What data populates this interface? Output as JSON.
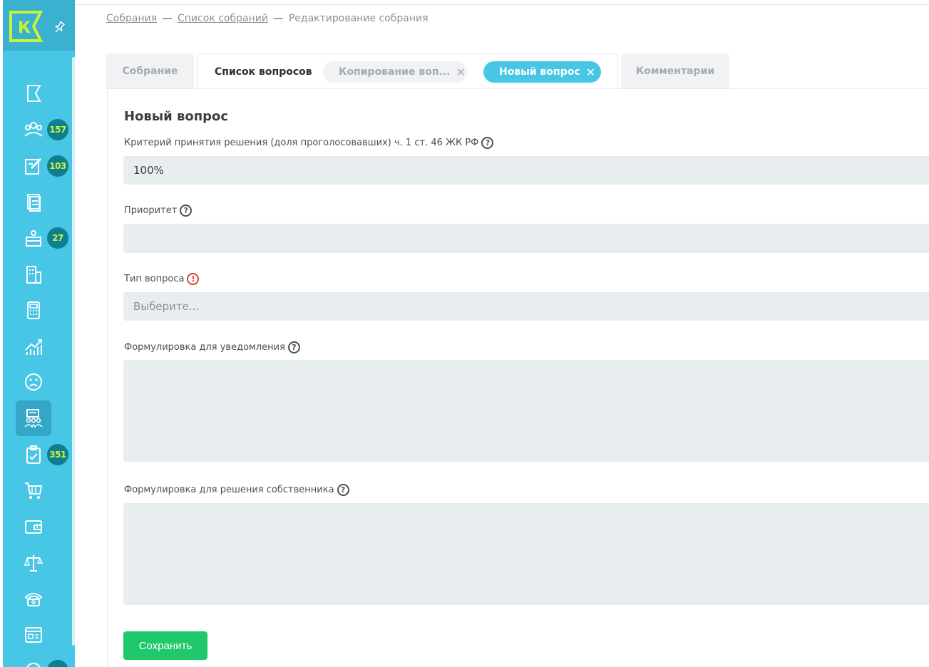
{
  "breadcrumb": {
    "item1": "Собрания",
    "sep": "—",
    "item2": "Список собраний",
    "current": "Редактирование собрания"
  },
  "tabs": {
    "meeting": "Собрание",
    "questions": "Список вопросов",
    "copy": "Копирование воп...",
    "new_question": "Новый вопрос",
    "comments": "Комментарии",
    "close_glyph": "✕"
  },
  "form": {
    "title": "Новый вопрос",
    "criterion_label": "Критерий принятия решения (доля проголосовавших) ч. 1 ст. 46 ЖК РФ",
    "criterion_value": "100%",
    "priority_label": "Приоритет",
    "priority_value": "",
    "type_label": "Тип вопроса",
    "type_placeholder": "Выберите...",
    "notice_label": "Формулировка для уведомления",
    "decision_label": "Формулировка для решения собственника",
    "help_glyph": "?",
    "warn_glyph": "!",
    "save_label": "Сохранить"
  },
  "sidebar": {
    "logo_letter": "К",
    "badges": [
      "157",
      "103",
      "27",
      "351"
    ]
  },
  "colors": {
    "sidebar": "#47c6e6",
    "badge_bg": "#0f7f8f",
    "badge_text": "#c8f33b",
    "save": "#1ec86b",
    "field": "#e8eef0"
  }
}
